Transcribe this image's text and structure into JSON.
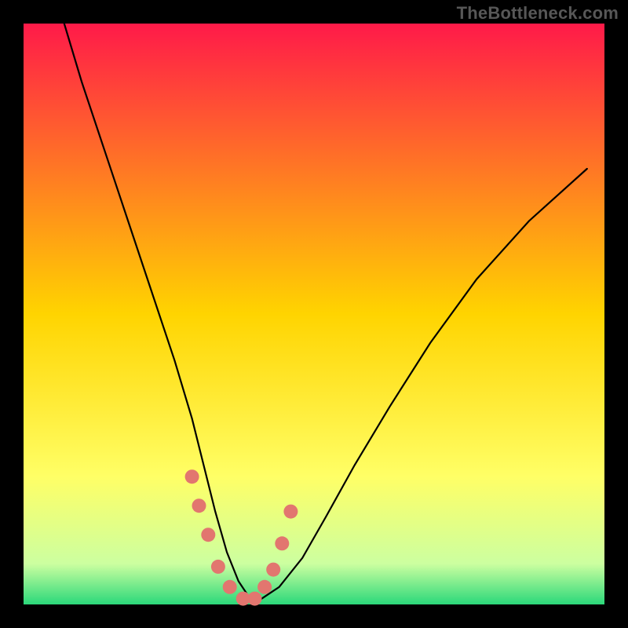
{
  "watermark": "TheBottleneck.com",
  "chart_data": {
    "type": "line",
    "title": "",
    "xlabel": "",
    "ylabel": "",
    "xlim": [
      0,
      100
    ],
    "ylim": [
      0,
      100
    ],
    "grid": false,
    "legend": false,
    "background_gradient": {
      "stops": [
        {
          "offset": 0.0,
          "color": "#ff1a49"
        },
        {
          "offset": 0.5,
          "color": "#ffd400"
        },
        {
          "offset": 0.78,
          "color": "#ffff66"
        },
        {
          "offset": 0.93,
          "color": "#ccffa0"
        },
        {
          "offset": 1.0,
          "color": "#2bd87a"
        }
      ]
    },
    "series": [
      {
        "name": "curve",
        "color": "#000000",
        "x": [
          7,
          10,
          14,
          18,
          22,
          26,
          29,
          31,
          33,
          35,
          37,
          39,
          41,
          44,
          48,
          52,
          57,
          63,
          70,
          78,
          87,
          97
        ],
        "y": [
          100,
          90,
          78,
          66,
          54,
          42,
          32,
          24,
          16,
          9,
          4,
          1,
          1,
          3,
          8,
          15,
          24,
          34,
          45,
          56,
          66,
          75
        ]
      },
      {
        "name": "highlight-dots",
        "color": "#e2766f",
        "x": [
          29.0,
          30.2,
          31.8,
          33.5,
          35.5,
          37.8,
          39.8,
          41.5,
          43.0,
          44.5,
          46.0
        ],
        "y": [
          22.0,
          17.0,
          12.0,
          6.5,
          3.0,
          1.0,
          1.0,
          3.0,
          6.0,
          10.5,
          16.0
        ]
      }
    ]
  }
}
